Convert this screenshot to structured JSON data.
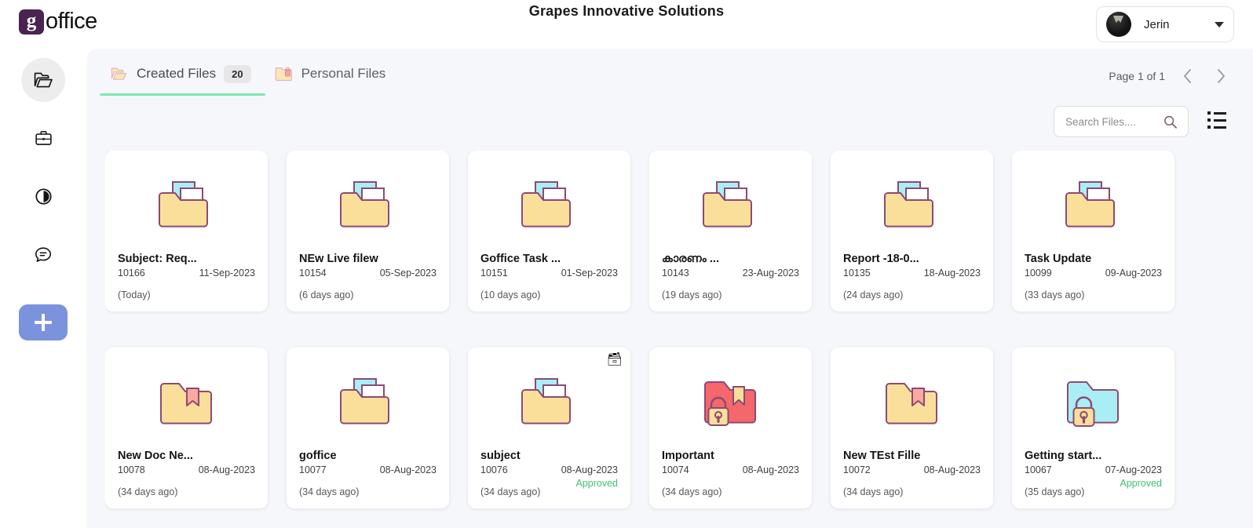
{
  "brand": {
    "logo_letter": "g",
    "logo_text": "office"
  },
  "header": {
    "title": "Grapes Innovative Solutions",
    "user": {
      "name": "Jerin",
      "avatar_icon": "user-avatar",
      "caret_icon": "chevron-down-icon"
    }
  },
  "sidebar": {
    "items": [
      {
        "icon": "folder-open-icon",
        "name": "files",
        "active": true
      },
      {
        "icon": "briefcase-icon",
        "name": "work",
        "active": false
      },
      {
        "icon": "clock-pie-icon",
        "name": "pending",
        "active": false
      },
      {
        "icon": "chat-bubble-icon",
        "name": "messages",
        "active": false
      }
    ],
    "add_button": {
      "icon": "plus-icon",
      "label": "+"
    }
  },
  "tabs": [
    {
      "label": "Created Files",
      "badge": "20",
      "icon": "folder-icon",
      "active": true
    },
    {
      "label": "Personal Files",
      "badge": "",
      "icon": "folder-lock-icon",
      "active": false
    }
  ],
  "pagination": {
    "text": "Page 1 of  1",
    "prev_icon": "chevron-left-icon",
    "next_icon": "chevron-right-icon"
  },
  "search": {
    "placeholder": "Search Files....",
    "value": "",
    "icon": "search-icon"
  },
  "view_toggle": {
    "icon": "list-view-icon"
  },
  "colors": {
    "accent_green": "#7ee8b0",
    "approved_green": "#3ec16a",
    "add_button_blue": "#7b92dd",
    "logo_purple": "#4a2352",
    "folder_yellow": "#fadf9a",
    "folder_red": "#f4676b",
    "folder_cyan": "#aaeef5",
    "folder_outline": "#8c4a73",
    "panel_bg": "#f6f7fa"
  },
  "cards": [
    {
      "title": "Subject: Req...",
      "id": "10166",
      "date": "11-Sep-2023",
      "status": "",
      "age": "(Today)",
      "icon": "folder-docs-icon",
      "badge": ""
    },
    {
      "title": "NEw Live filew",
      "id": "10154",
      "date": "05-Sep-2023",
      "status": "",
      "age": "(6 days ago)",
      "icon": "folder-docs-icon",
      "badge": ""
    },
    {
      "title": "Goffice Task ...",
      "id": "10151",
      "date": "01-Sep-2023",
      "status": "",
      "age": "(10 days ago)",
      "icon": "folder-docs-icon",
      "badge": ""
    },
    {
      "title": "കാരണം ...",
      "id": "10143",
      "date": "23-Aug-2023",
      "status": "",
      "age": "(19 days ago)",
      "icon": "folder-docs-icon",
      "badge": ""
    },
    {
      "title": "Report -18-0...",
      "id": "10135",
      "date": "18-Aug-2023",
      "status": "",
      "age": "(24 days ago)",
      "icon": "folder-docs-icon",
      "badge": ""
    },
    {
      "title": "Task Update",
      "id": "10099",
      "date": "09-Aug-2023",
      "status": "",
      "age": "(33 days ago)",
      "icon": "folder-docs-icon",
      "badge": ""
    },
    {
      "title": "New Doc Ne...",
      "id": "10078",
      "date": "08-Aug-2023",
      "status": "",
      "age": "(34 days ago)",
      "icon": "folder-bookmark-icon",
      "badge": ""
    },
    {
      "title": "goffice",
      "id": "10077",
      "date": "08-Aug-2023",
      "status": "",
      "age": "(34 days ago)",
      "icon": "folder-docs-icon",
      "badge": ""
    },
    {
      "title": "subject",
      "id": "10076",
      "date": "08-Aug-2023",
      "status": "Approved",
      "age": "(34 days ago)",
      "icon": "folder-docs-icon",
      "badge": "🗃"
    },
    {
      "title": "Important",
      "id": "10074",
      "date": "08-Aug-2023",
      "status": "",
      "age": "(34 days ago)",
      "icon": "folder-red-lock-icon",
      "badge": ""
    },
    {
      "title": "New TEst Fille",
      "id": "10072",
      "date": "08-Aug-2023",
      "status": "",
      "age": "(34 days ago)",
      "icon": "folder-bookmark-icon",
      "badge": ""
    },
    {
      "title": "Getting start...",
      "id": "10067",
      "date": "07-Aug-2023",
      "status": "Approved",
      "age": "(35 days ago)",
      "icon": "folder-cyan-lock-icon",
      "badge": ""
    }
  ]
}
